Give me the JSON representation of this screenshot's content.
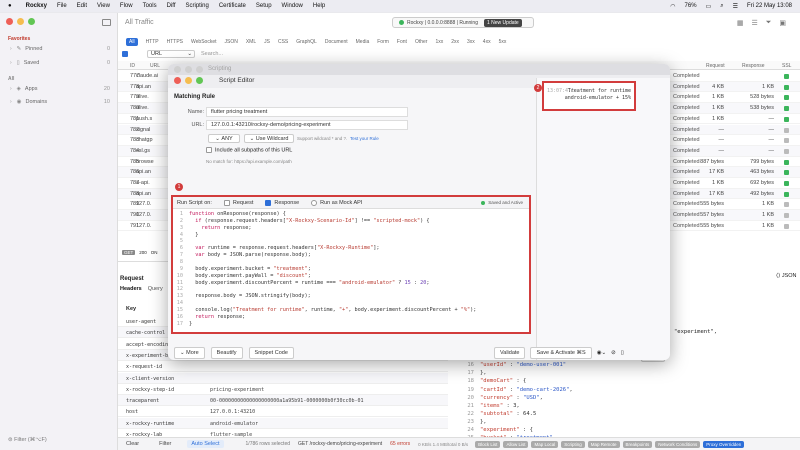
{
  "menubar": {
    "apple": "",
    "app": "Rockxy",
    "items": [
      "File",
      "Edit",
      "View",
      "Flow",
      "Tools",
      "Diff",
      "Scripting",
      "Certificate",
      "Setup",
      "Window",
      "Help"
    ],
    "status": {
      "battery": "76%",
      "datetime": "Fri 22 May 13:08"
    }
  },
  "sidebar": {
    "favorites_heading": "Favorites",
    "pinned": {
      "label": "Pinned",
      "count": "0"
    },
    "saved": {
      "label": "Saved",
      "count": "0"
    },
    "all_heading": "All",
    "apps": {
      "label": "Apps",
      "count": "20"
    },
    "domains": {
      "label": "Domains",
      "count": "10"
    },
    "filter": "Filter (⌘⌥F)"
  },
  "toolbar": {
    "title": "All Traffic",
    "status_text": "Rockxy | 0.0.0.0:8888 | Running",
    "new_update": "1 New Update"
  },
  "filter_tabs": [
    "All",
    "HTTP",
    "HTTPS",
    "WebSocket",
    "JSON",
    "XML",
    "JS",
    "CSS",
    "GraphQL",
    "Document",
    "Media",
    "Form",
    "Font",
    "Other",
    "1xx",
    "2xx",
    "3xx",
    "4xx",
    "5xx"
  ],
  "search": {
    "field": "URL",
    "placeholder": "Search..."
  },
  "table": {
    "headers": {
      "id": "ID",
      "url": "URL",
      "request": "Request",
      "response": "Response",
      "ssl": "SSL"
    },
    "rows": [
      {
        "id": "777",
        "url": "claude.ai",
        "status": "Completed",
        "request": "",
        "response": "",
        "ssl": "green"
      },
      {
        "id": "778",
        "url": "api.an",
        "status": "Completed",
        "request": "4 KB",
        "response": "1 KB",
        "ssl": "green"
      },
      {
        "id": "779",
        "url": "alive.",
        "status": "Completed",
        "request": "1 KB",
        "response": "528 bytes",
        "ssl": "green"
      },
      {
        "id": "780",
        "url": "alive.",
        "status": "Completed",
        "request": "1 KB",
        "response": "538 bytes",
        "ssl": "green"
      },
      {
        "id": "781",
        "url": "push.s",
        "status": "Completed",
        "request": "1 KB",
        "response": "—",
        "ssl": "green"
      },
      {
        "id": "782",
        "url": "signal",
        "status": "Completed",
        "request": "—",
        "response": "—",
        "ssl": "gray"
      },
      {
        "id": "783",
        "url": "chatgp",
        "status": "Completed",
        "request": "—",
        "response": "—",
        "ssl": "gray"
      },
      {
        "id": "784",
        "url": "ssl.gs",
        "status": "Completed",
        "request": "—",
        "response": "—",
        "ssl": "gray"
      },
      {
        "id": "785",
        "url": "browse",
        "status": "Completed",
        "request": "887 bytes",
        "response": "799 bytes",
        "ssl": "green"
      },
      {
        "id": "786",
        "url": "api.an",
        "status": "Completed",
        "request": "17 KB",
        "response": "463 bytes",
        "ssl": "green"
      },
      {
        "id": "787",
        "url": "a-api.",
        "status": "Completed",
        "request": "1 KB",
        "response": "692 bytes",
        "ssl": "green"
      },
      {
        "id": "788",
        "url": "api.an",
        "status": "Completed",
        "request": "17 KB",
        "response": "492 bytes",
        "ssl": "green"
      },
      {
        "id": "789",
        "url": "127.0.",
        "status": "Completed",
        "request": "555 bytes",
        "response": "1 KB",
        "ssl": "gray"
      },
      {
        "id": "790",
        "url": "127.0.",
        "status": "Completed",
        "request": "557 bytes",
        "response": "1 KB",
        "ssl": "gray"
      },
      {
        "id": "791",
        "url": "127.0.",
        "status": "Completed",
        "request": "555 bytes",
        "response": "1 KB",
        "ssl": "gray"
      }
    ],
    "selected_method": "GET",
    "selected_code": "200",
    "selected_prefix": "ON"
  },
  "request_panel": {
    "title": "Request",
    "tabs": [
      "Headers",
      "Query",
      "B"
    ],
    "key_header": "Key",
    "headers": [
      {
        "key": "user-agent",
        "value": ""
      },
      {
        "key": "cache-control",
        "value": ""
      },
      {
        "key": "accept-encoding",
        "value": ""
      },
      {
        "key": "x-experiment-bu",
        "value": ""
      },
      {
        "key": "x-request-id",
        "value": ""
      },
      {
        "key": "x-client-version",
        "value": ""
      },
      {
        "key": "x-rockxy-step-id",
        "value": "pricing-experiment"
      },
      {
        "key": "traceparent",
        "value": "00-00000000000000000000a1a95b91-0000000b0f30cc0b-01"
      },
      {
        "key": "host",
        "value": "127.0.0.1:43210"
      },
      {
        "key": "x-rockxy-runtime",
        "value": "android-emulator"
      },
      {
        "key": "x-rockxy-lab",
        "value": "flutter-sample"
      },
      {
        "key": "x-rockxy-lab-run-id",
        "value": "run-1779428190267826"
      }
    ]
  },
  "response_panel": {
    "format": "JSON",
    "lines": [
      {
        "n": "",
        "t": "\"experiment\","
      },
      {
        "n": "",
        "t": ""
      },
      {
        "n": "",
        "t": ""
      },
      {
        "n": "",
        "t": ""
      },
      {
        "n": "",
        "t": ""
      },
      {
        "n": "",
        "t": ""
      },
      {
        "n": "",
        "t": ""
      },
      {
        "n": "",
        "t": ""
      },
      {
        "n": "",
        "t": ""
      },
      {
        "n": "",
        "t": ""
      },
      {
        "n": "14",
        "t": "  \"plan\" : \"trial\","
      },
      {
        "n": "15",
        "t": "  \"region\" : \"us\","
      },
      {
        "n": "16",
        "t": "  \"userId\" : \"demo-user-001\""
      },
      {
        "n": "17",
        "t": "},"
      },
      {
        "n": "18",
        "t": "\"demoCart\" : {"
      },
      {
        "n": "19",
        "t": "  \"cartId\" : \"demo-cart-2026\","
      },
      {
        "n": "20",
        "t": "  \"currency\" : \"USD\","
      },
      {
        "n": "21",
        "t": "  \"items\" : 3,"
      },
      {
        "n": "22",
        "t": "  \"subtotal\" : 64.5"
      },
      {
        "n": "23",
        "t": "},"
      },
      {
        "n": "24",
        "t": "\"experiment\" : {"
      },
      {
        "n": "25",
        "t": "  \"bucket\" : \"treatment\","
      }
    ]
  },
  "bottom_bar": {
    "clear": "Clear",
    "filter": "Filter",
    "auto_select": "Auto Select",
    "rows_selected": "1/786 rows selected",
    "current": "GET /rockxy-demo/pricing-experiment",
    "errors": "65 errors",
    "stats": "0 KB/s   1.4 MB/total   0 B/s",
    "tags": [
      "Block List",
      "Allow List",
      "Map Local",
      "Scripting",
      "Map Remote",
      "Breakpoints",
      "Network Conditions",
      "Proxy Overridden"
    ]
  },
  "script_editor": {
    "back_title": "Scripting",
    "title": "Script Editor",
    "matching_rule": "Matching Rule",
    "name_label": "Name:",
    "name_value": "flutter pricing treatment",
    "url_label": "URL:",
    "url_value": "127.0.0.1:43210/rockxy-demo/pricing-experiment",
    "method": "ANY",
    "wildcard": "Use Wildcard",
    "wildcard_hint": "Support wildcard * and ?.",
    "test_rule": "Test your Rule",
    "subpaths": "Include all subpaths of this URL",
    "match_hint": "No match for: https://api.example.com/path",
    "run_on_label": "Run Script on:",
    "run_request": "Request",
    "run_response": "Response",
    "run_mock": "Run as Mock API",
    "saved_status": "Saved and Active",
    "code": [
      "function onResponse(response) {",
      "  if (response.request.headers[\"X-Rockxy-Scenario-Id\"] !== \"scripted-mock\") {",
      "    return response;",
      "  }",
      "",
      "  var runtime = response.request.headers[\"X-Rockxy-Runtime\"];",
      "  var body = JSON.parse(response.body);",
      "",
      "  body.experiment.bucket = \"treatment\";",
      "  body.experiment.payWall = \"discount\";",
      "  body.experiment.discountPercent = runtime === \"android-emulator\" ? 15 : 20;",
      "",
      "  response.body = JSON.stringify(body);",
      "",
      "  console.log(\"Treatment for runtime\", runtime, \"+\", body.experiment.discountPercent + \"%\");",
      "  return response;",
      "}"
    ],
    "more": "More",
    "beautify": "Beautify",
    "snippet": "Snippet Code",
    "validate": "Validate",
    "save_activate": "Save & Activate ⌘S",
    "console_time": "13:07:4.1",
    "console_msg_1": "Treatment for runtime",
    "console_msg_2": "android-emulator + 15%",
    "more_right": "More",
    "badge1": "1",
    "badge2": "2"
  }
}
